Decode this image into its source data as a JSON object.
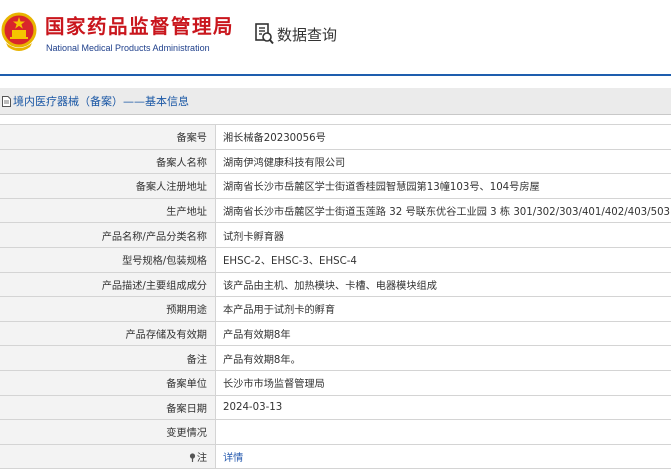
{
  "header": {
    "brand_cn": "国家药品监督管理局",
    "brand_en": "National Medical Products Administration",
    "query_label": "数据查询",
    "emblem_icon": "national-emblem-icon",
    "query_icon": "document-search-icon"
  },
  "section": {
    "title": "境内医疗器械（备案）——基本信息",
    "icon": "document-icon"
  },
  "rows": [
    {
      "label": "备案号",
      "value": "湘长械备20230056号"
    },
    {
      "label": "备案人名称",
      "value": "湖南伊鸿健康科技有限公司"
    },
    {
      "label": "备案人注册地址",
      "value": "湖南省长沙市岳麓区学士街道香桂园智慧园第13幢103号、104号房屋"
    },
    {
      "label": "生产地址",
      "value": "湖南省长沙市岳麓区学士街道玉莲路 32 号联东优谷工业园 3 栋 301/302/303/401/402/403/503"
    },
    {
      "label": "产品名称/产品分类名称",
      "value": "试剂卡孵育器"
    },
    {
      "label": "型号规格/包装规格",
      "value": "EHSC-2、EHSC-3、EHSC-4"
    },
    {
      "label": "产品描述/主要组成成分",
      "value": "该产品由主机、加热模块、卡槽、电器模块组成"
    },
    {
      "label": "预期用途",
      "value": "本产品用于试剂卡的孵育"
    },
    {
      "label": "产品存储及有效期",
      "value": "产品有效期8年"
    },
    {
      "label": "备注",
      "value": "产品有效期8年。"
    },
    {
      "label": "备案单位",
      "value": "长沙市市场监督管理局"
    },
    {
      "label": "备案日期",
      "value": "2024-03-13"
    },
    {
      "label": "变更情况",
      "value": ""
    },
    {
      "label": "注",
      "value": "详情",
      "label_icon": "pin-icon"
    }
  ],
  "colors": {
    "brand_red": "#c9161d",
    "brand_blue": "#1e3f8b",
    "accent_line": "#1e5eae",
    "link_blue": "#2a5db0"
  }
}
